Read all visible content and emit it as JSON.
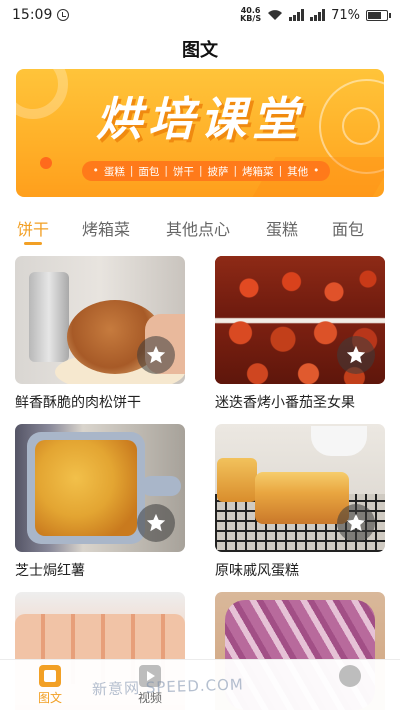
{
  "status_bar": {
    "time": "15:09",
    "net_speed_value": "40.6",
    "net_speed_unit": "KB/S",
    "battery": "71%"
  },
  "header": {
    "title": "图文"
  },
  "banner": {
    "title": "烘培课堂",
    "tags": [
      "蛋糕",
      "面包",
      "饼干",
      "披萨",
      "烤箱菜",
      "其他"
    ]
  },
  "tabs": [
    "饼干",
    "烤箱菜",
    "其他点心",
    "蛋糕",
    "面包"
  ],
  "active_tab": "饼干",
  "recipes": [
    {
      "title": "鲜香酥脆的肉松饼干"
    },
    {
      "title": "迷迭香烤小番茄圣女果"
    },
    {
      "title": "芝士焗红薯"
    },
    {
      "title": "原味戚风蛋糕"
    },
    {
      "title": ""
    },
    {
      "title": ""
    }
  ],
  "bottom_nav": [
    {
      "label": "图文",
      "icon": "article-icon",
      "active": true
    },
    {
      "label": "视频",
      "icon": "video-icon",
      "active": false
    },
    {
      "label": "",
      "icon": "profile-icon",
      "active": false
    }
  ],
  "watermark": "新意网  SPEED.COM",
  "colors": {
    "accent": "#f2a025",
    "banner": "#ffb129",
    "tag_pill": "#ff7a1a"
  }
}
